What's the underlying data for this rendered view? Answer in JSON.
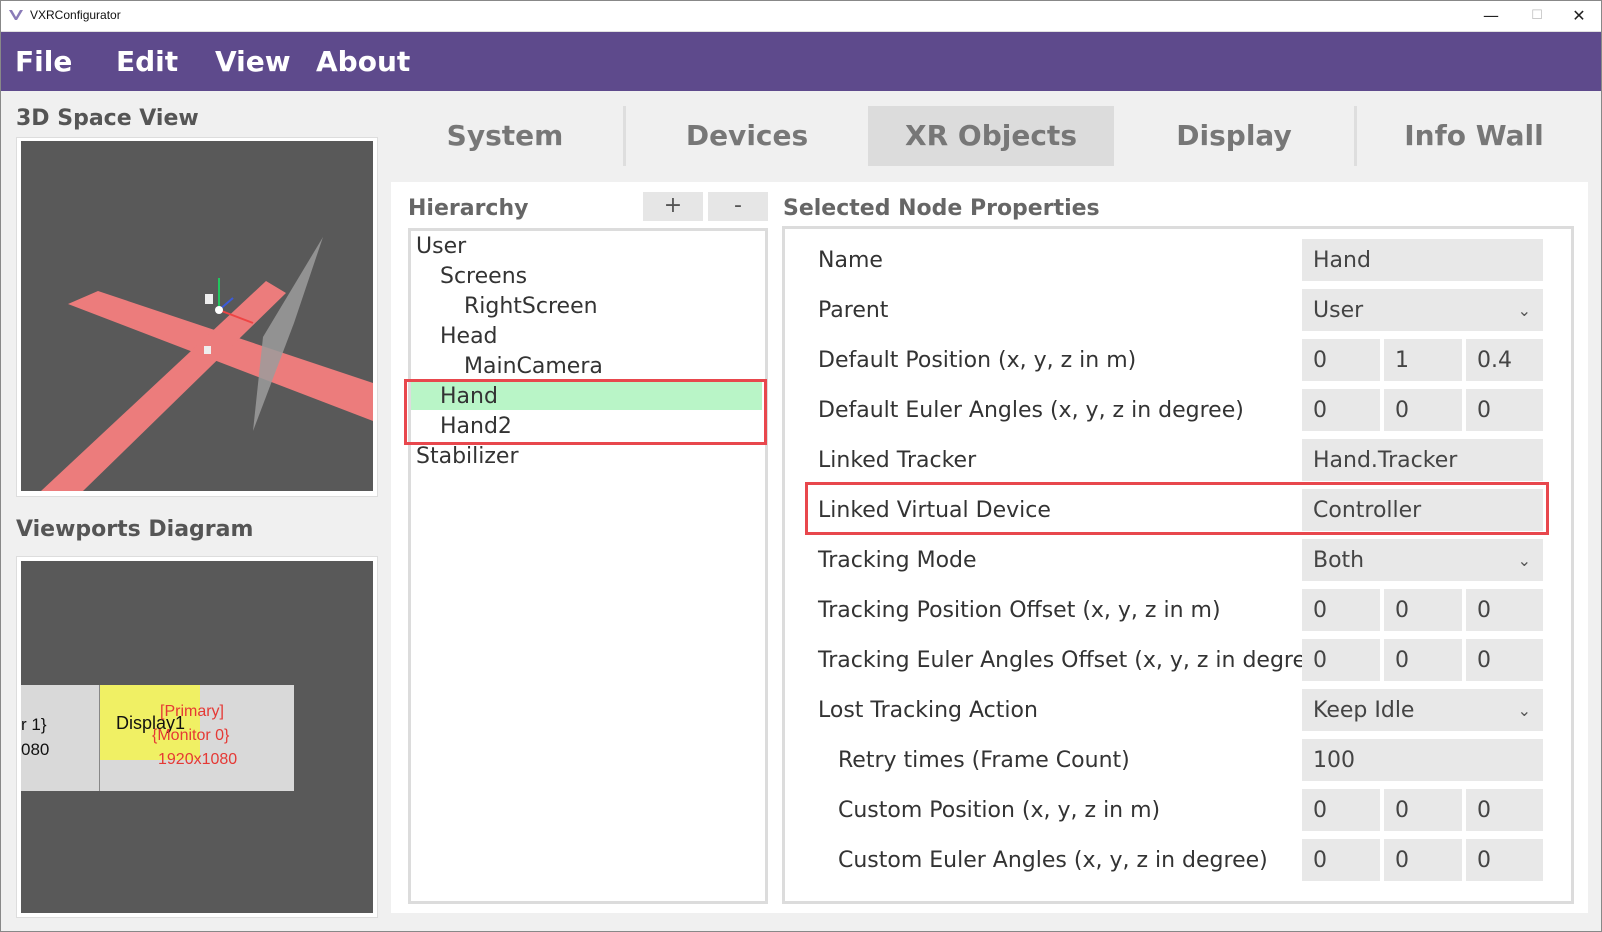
{
  "window": {
    "title": "VXRConfigurator",
    "minimize": "—",
    "maximize": "☐",
    "close": "✕"
  },
  "menu": [
    "File",
    "Edit",
    "View",
    "About"
  ],
  "left": {
    "space_view_label": "3D Space View",
    "viewports_label": "Viewports Diagram",
    "viewports": {
      "left_display_lines": [
        "r 1}",
        "080"
      ],
      "display_label": "Display1",
      "primary": "[Primary]",
      "monitor": "{Monitor 0}",
      "resolution": "1920x1080"
    }
  },
  "tabs": [
    {
      "label": "System",
      "active": false
    },
    {
      "label": "Devices",
      "active": false
    },
    {
      "label": "XR Objects",
      "active": true
    },
    {
      "label": "Display",
      "active": false
    },
    {
      "label": "Info Wall",
      "active": false
    }
  ],
  "hierarchy": {
    "title": "Hierarchy",
    "add": "+",
    "remove": "-",
    "items": [
      {
        "label": "User",
        "depth": 0
      },
      {
        "label": "Screens",
        "depth": 1
      },
      {
        "label": "RightScreen",
        "depth": 2
      },
      {
        "label": "Head",
        "depth": 1
      },
      {
        "label": "MainCamera",
        "depth": 2
      },
      {
        "label": "Hand",
        "depth": 1,
        "selected": true
      },
      {
        "label": "Hand2",
        "depth": 1
      },
      {
        "label": "Stabilizer",
        "depth": 0
      }
    ]
  },
  "properties": {
    "title": "Selected Node Properties",
    "rows": [
      {
        "label": "Name",
        "values": [
          "Hand"
        ]
      },
      {
        "label": "Parent",
        "values": [
          "User"
        ],
        "dropdown": true
      },
      {
        "label": "Default Position (x, y, z in m)",
        "values": [
          "0",
          "1",
          "0.4"
        ]
      },
      {
        "label": "Default Euler Angles (x, y, z in degree)",
        "values": [
          "0",
          "0",
          "0"
        ]
      },
      {
        "label": "Linked Tracker",
        "values": [
          "Hand.Tracker"
        ]
      },
      {
        "label": "Linked Virtual Device",
        "values": [
          "Controller"
        ],
        "highlighted": true
      },
      {
        "label": "Tracking Mode",
        "values": [
          "Both"
        ],
        "dropdown": true
      },
      {
        "label": "Tracking Position Offset (x, y, z in m)",
        "values": [
          "0",
          "0",
          "0"
        ]
      },
      {
        "label": "Tracking Euler Angles Offset (x, y, z in degree)",
        "values": [
          "0",
          "0",
          "0"
        ]
      },
      {
        "label": "Lost Tracking Action",
        "values": [
          "Keep Idle"
        ],
        "dropdown": true
      },
      {
        "label": "Retry times (Frame Count)",
        "values": [
          "100"
        ],
        "indent": true
      },
      {
        "label": "Custom Position (x, y, z in m)",
        "values": [
          "0",
          "0",
          "0"
        ],
        "indent": true
      },
      {
        "label": "Custom Euler Angles (x, y, z in degree)",
        "values": [
          "0",
          "0",
          "0"
        ],
        "indent": true
      }
    ]
  },
  "colors": {
    "menubar": "#5e4a8c",
    "highlight": "#e8474d",
    "selection": "#b9f5c7"
  }
}
